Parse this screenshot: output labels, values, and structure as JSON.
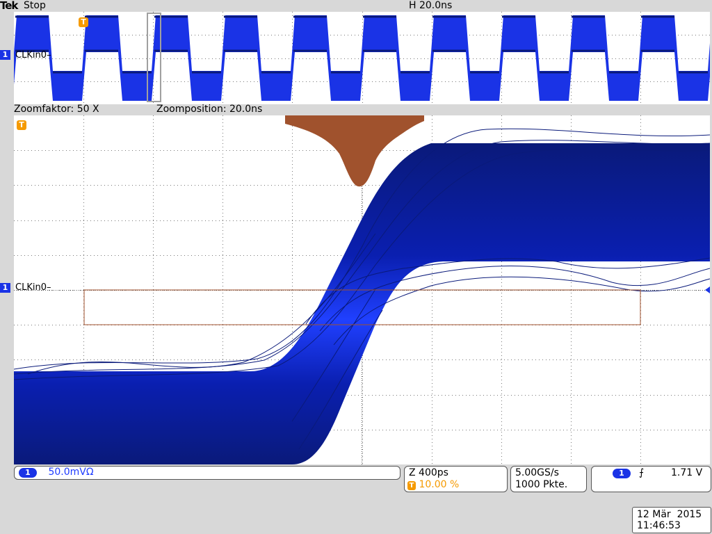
{
  "header": {
    "brand": "Tek",
    "run_state": "Stop",
    "horizontal_scale": "H 20.0ns"
  },
  "overview": {
    "channel_marker": "1",
    "channel_label": "CLKin0",
    "trigger_marker": "T"
  },
  "zoom": {
    "factor_label": "Zoomfaktor: 50 X",
    "position_label": "Zoomposition: 20.0ns"
  },
  "main": {
    "channel_marker": "1",
    "channel_label": "CLKin0",
    "trigger_marker": "T"
  },
  "status": {
    "channel_number": "1",
    "channel_scale": "50.0mVΩ",
    "zoom_timebase": "Z 400ps",
    "trigger_marker": "T",
    "trigger_position": "10.00 %",
    "sample_rate": "5.00GS/s",
    "record_length": "1000 Pkte.",
    "trigger_channel": "1",
    "trigger_slope_symbol": "⨍",
    "trigger_level": "1.71 V"
  },
  "datetime": {
    "date": "12 Mär  2015",
    "time": "11:46:53"
  },
  "colors": {
    "waveform_blue": "#1a33e6",
    "waveform_dark": "#0a1a7a",
    "histogram_brown": "#a0522d",
    "trigger_orange": "#f59a00"
  }
}
